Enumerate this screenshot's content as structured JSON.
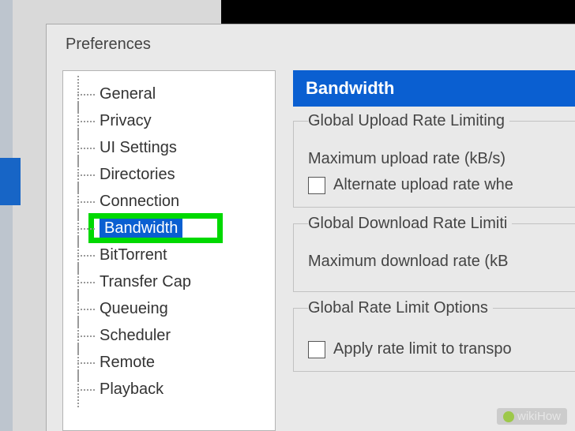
{
  "window": {
    "title": "Preferences"
  },
  "tree": {
    "items": [
      {
        "label": "General"
      },
      {
        "label": "Privacy"
      },
      {
        "label": "UI Settings"
      },
      {
        "label": "Directories"
      },
      {
        "label": "Connection"
      },
      {
        "label": "Bandwidth",
        "selected": true,
        "highlighted": true
      },
      {
        "label": "BitTorrent"
      },
      {
        "label": "Transfer Cap"
      },
      {
        "label": "Queueing"
      },
      {
        "label": "Scheduler"
      },
      {
        "label": "Remote"
      },
      {
        "label": "Playback"
      }
    ]
  },
  "settings": {
    "header": "Bandwidth",
    "group_upload": {
      "legend": "Global Upload Rate Limiting",
      "max_label": "Maximum upload rate (kB/s)",
      "alt_checkbox_label": "Alternate upload rate whe"
    },
    "group_download": {
      "legend": "Global Download Rate Limiti",
      "max_label": "Maximum download rate (kB"
    },
    "group_global": {
      "legend": "Global Rate Limit Options",
      "apply_checkbox_label": "Apply rate limit to transpo"
    }
  },
  "watermark": {
    "text": "wikiHow"
  }
}
